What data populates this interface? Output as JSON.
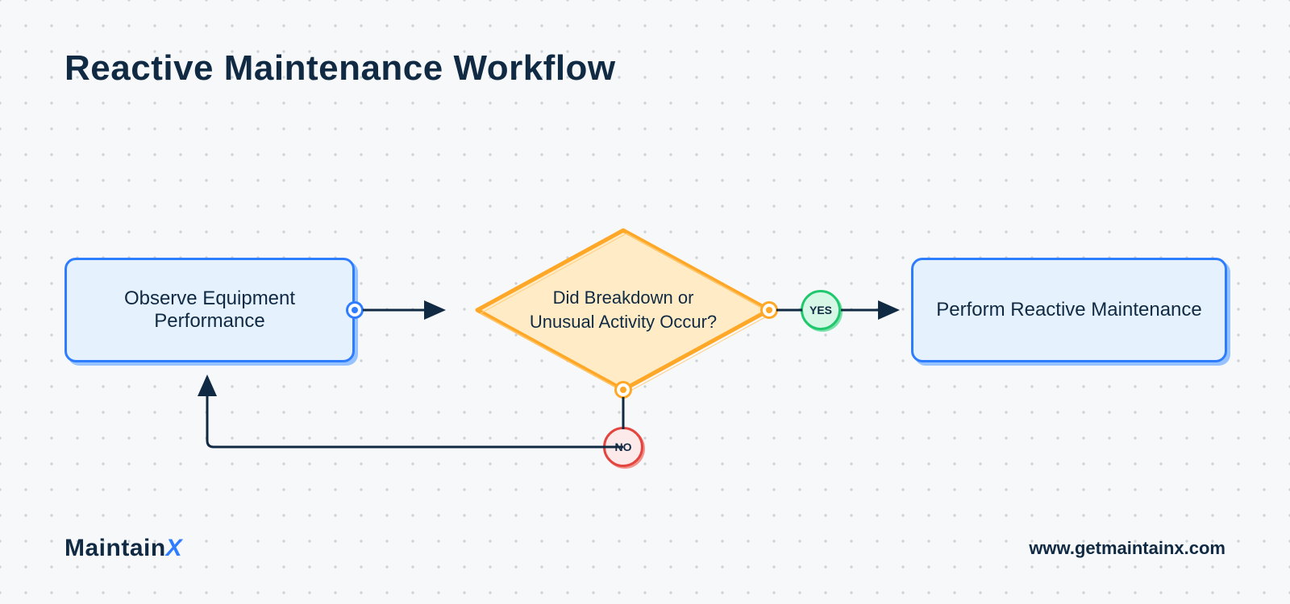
{
  "title": "Reactive Maintenance Workflow",
  "nodes": {
    "observe": "Observe Equipment Performance",
    "decision": "Did Breakdown or Unusual Activity Occur?",
    "perform": "Perform Reactive Maintenance"
  },
  "branches": {
    "yes": "YES",
    "no": "NO"
  },
  "brand": {
    "name": "Maintain",
    "accent": "X"
  },
  "url": "www.getmaintainx.com",
  "colors": {
    "primary": "#2e7dff",
    "orange": "#ffa726",
    "dark": "#102a43",
    "green": "#1fc86d",
    "red": "#e4443e"
  }
}
